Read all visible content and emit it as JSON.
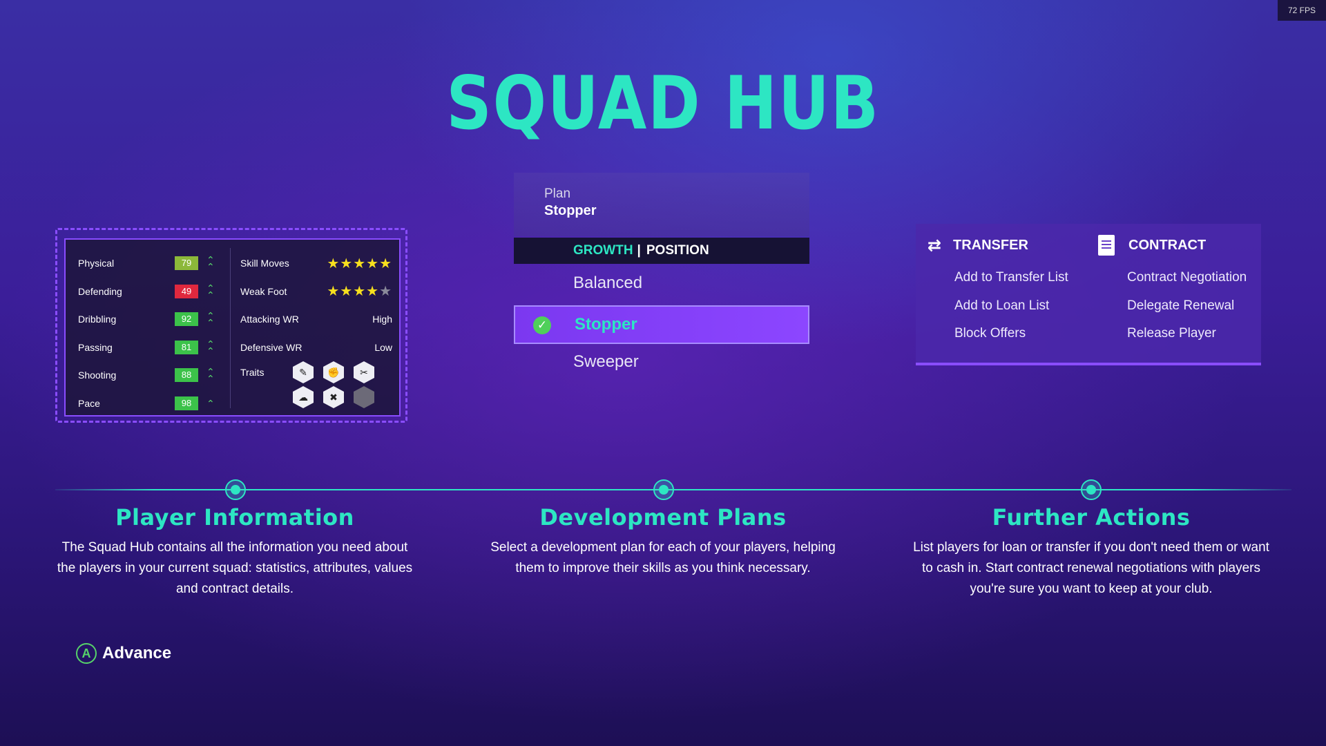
{
  "fps": "72 FPS",
  "title": "SQUAD HUB",
  "colors": {
    "accent": "#2de6c3",
    "purple": "#8a4dff",
    "green": "#56d36a",
    "red": "#e0283e",
    "olive": "#8cb83a"
  },
  "stat_card": {
    "attributes": [
      {
        "name": "Physical",
        "value": "79",
        "color": "#8cb83a"
      },
      {
        "name": "Defending",
        "value": "49",
        "color": "#e0283e"
      },
      {
        "name": "Dribbling",
        "value": "92",
        "color": "#3cc24a"
      },
      {
        "name": "Passing",
        "value": "81",
        "color": "#3cc24a"
      },
      {
        "name": "Shooting",
        "value": "88",
        "color": "#3cc24a"
      },
      {
        "name": "Pace",
        "value": "98",
        "color": "#3cc24a"
      }
    ],
    "skill_moves_label": "Skill Moves",
    "skill_moves_stars": 5,
    "weak_foot_label": "Weak Foot",
    "weak_foot_stars": 4,
    "attacking_wr_label": "Attacking WR",
    "attacking_wr_value": "High",
    "defensive_wr_label": "Defensive WR",
    "defensive_wr_value": "Low",
    "traits_label": "Traits"
  },
  "plan": {
    "label": "Plan",
    "value": "Stopper",
    "tab_growth": "GROWTH",
    "tab_sep": "|",
    "tab_position": "POSITION",
    "options": [
      "Balanced",
      "Stopper",
      "Sweeper"
    ],
    "selected": "Stopper"
  },
  "actions": {
    "transfer_title": "TRANSFER",
    "transfer_items": [
      "Add to Transfer List",
      "Add to Loan List",
      "Block Offers"
    ],
    "contract_title": "CONTRACT",
    "contract_items": [
      "Contract Negotiation",
      "Delegate Renewal",
      "Release Player"
    ]
  },
  "sections": [
    {
      "title": "Player Information",
      "text": "The Squad Hub contains all the information you need about the players in your current squad: statistics, attributes, values and contract details."
    },
    {
      "title": "Development Plans",
      "text": "Select a development plan for each of your players, helping them to improve their skills as you think necessary."
    },
    {
      "title": "Further Actions",
      "text": "List players for loan or transfer if you don't need them or want to cash in. Start contract renewal negotiations with players you're sure you want to keep at your club."
    }
  ],
  "advance": {
    "button": "A",
    "label": "Advance"
  }
}
